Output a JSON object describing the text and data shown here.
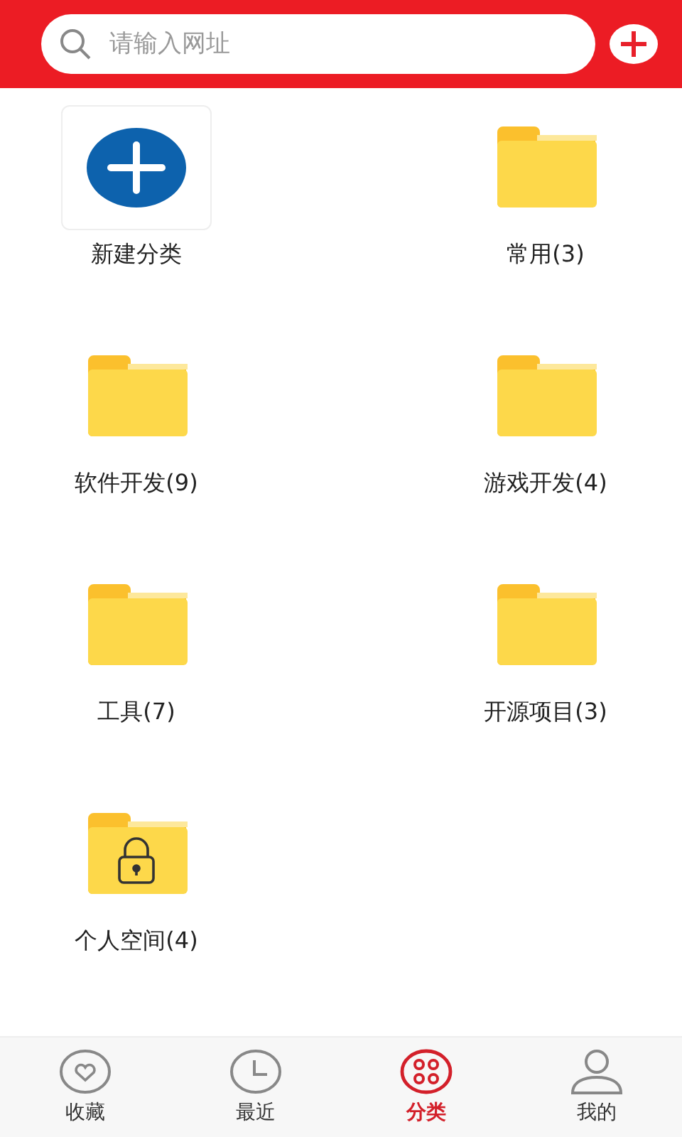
{
  "search": {
    "placeholder": "请输入网址"
  },
  "categories": [
    {
      "kind": "new",
      "label": "新建分类"
    },
    {
      "kind": "folder",
      "label": "常用(3)"
    },
    {
      "kind": "folder",
      "label": "软件开发(9)"
    },
    {
      "kind": "folder",
      "label": "游戏开发(4)"
    },
    {
      "kind": "folder",
      "label": "工具(7)"
    },
    {
      "kind": "folder",
      "label": "开源项目(3)"
    },
    {
      "kind": "locked",
      "label": "个人空间(4)"
    }
  ],
  "nav": [
    {
      "kind": "heart",
      "label": "收藏",
      "selected": false
    },
    {
      "kind": "clock",
      "label": "最近",
      "selected": false
    },
    {
      "kind": "grid",
      "label": "分类",
      "selected": true
    },
    {
      "kind": "person",
      "label": "我的",
      "selected": false
    }
  ]
}
